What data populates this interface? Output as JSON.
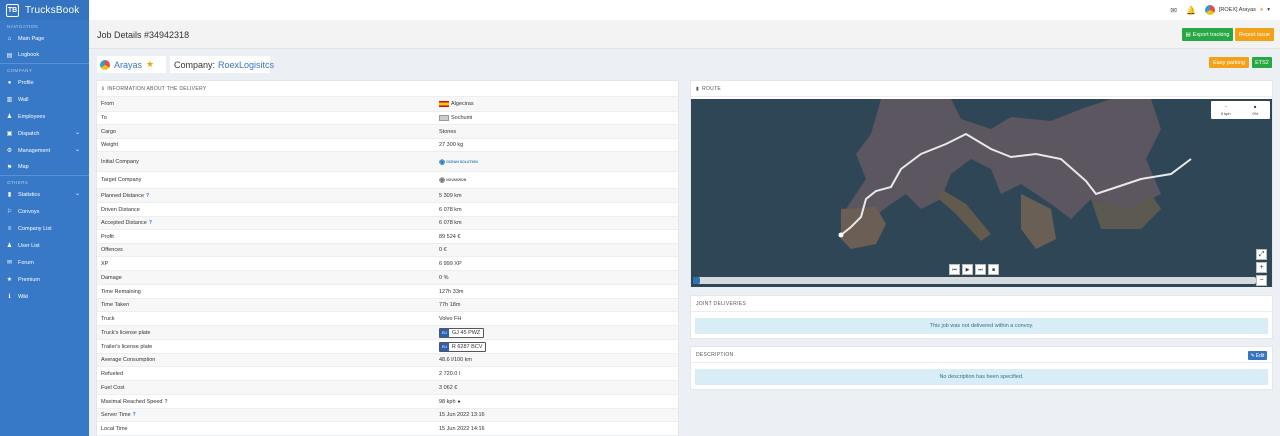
{
  "app": {
    "name": "TrucksBook",
    "logo_text": "TB"
  },
  "sidebar": {
    "sections": [
      "Navigation",
      "Company",
      "Others"
    ],
    "items": [
      {
        "label": "Main Page",
        "icon": "home-icon"
      },
      {
        "label": "Logbook",
        "icon": "book-icon"
      },
      {
        "label": "Profile",
        "icon": "user-icon"
      },
      {
        "label": "Wall",
        "icon": "wall-icon"
      },
      {
        "label": "Employees",
        "icon": "users-icon"
      },
      {
        "label": "Dispatch",
        "icon": "truck-icon"
      },
      {
        "label": "Management",
        "icon": "gear-icon"
      },
      {
        "label": "Map",
        "icon": "map-icon"
      },
      {
        "label": "Statistics",
        "icon": "chart-icon"
      },
      {
        "label": "Convoys",
        "icon": "convoy-icon"
      },
      {
        "label": "Company List",
        "icon": "list-icon"
      },
      {
        "label": "User List",
        "icon": "user-list-icon"
      },
      {
        "label": "Forum",
        "icon": "forum-icon"
      },
      {
        "label": "Premium",
        "icon": "star-icon"
      },
      {
        "label": "Wiki",
        "icon": "info-icon"
      }
    ]
  },
  "topbar": {
    "user_label": "[ROEX] Arayas"
  },
  "page": {
    "title": "Job Details #34942318"
  },
  "actions": {
    "export": "Export tracking",
    "report": "Report issue"
  },
  "driver": {
    "name": "Arayas"
  },
  "company": {
    "prefix": "Company:",
    "name": "RoexLogisitcs"
  },
  "badges": {
    "parking": "Easy parking",
    "game": "ETS2"
  },
  "info": {
    "heading": "Information about the delivery",
    "rows": [
      {
        "label": "From",
        "value": "Algeciras"
      },
      {
        "label": "To",
        "value": "Sochumi"
      },
      {
        "label": "Cargo",
        "value": "Stones"
      },
      {
        "label": "Weight",
        "value": "27 300 kg"
      },
      {
        "label": "Initial Company",
        "value": "OCEAN SOLUTION"
      },
      {
        "label": "Target Company",
        "value": "NOVAKRON"
      },
      {
        "label": "Planned Distance",
        "value": "5 309 km"
      },
      {
        "label": "Driven Distance",
        "value": "6 078 km"
      },
      {
        "label": "Accepted Distance",
        "value": "6 078 km"
      },
      {
        "label": "Profit",
        "value": "89 524 €"
      },
      {
        "label": "Offences",
        "value": "0 €"
      },
      {
        "label": "XP",
        "value": "6 999 XP"
      },
      {
        "label": "Damage",
        "value": "0 %"
      },
      {
        "label": "Time Remaining",
        "value": "127h 33m"
      },
      {
        "label": "Time Taken",
        "value": "77h 18m"
      },
      {
        "label": "Truck",
        "value": "Volvo FH"
      },
      {
        "label": "Truck's license plate",
        "value": "GJ 45 PWZ"
      },
      {
        "label": "Trailer's license plate",
        "value": "R 6287 BCV"
      },
      {
        "label": "Average Consumption",
        "value": "48.6 l/100 km"
      },
      {
        "label": "Refueled",
        "value": "2 720.0 l"
      },
      {
        "label": "Fuel Cost",
        "value": "3 062 €"
      },
      {
        "label": "Maximal Reached Speed",
        "value": "98 kph"
      },
      {
        "label": "Server Time",
        "value": "15 Jun 2022 13:16"
      },
      {
        "label": "Local Time",
        "value": "15 Jun 2022 14:16"
      }
    ]
  },
  "plate_country": "EU",
  "route": {
    "heading": "Route",
    "speed": "0 kph",
    "progress": "0%",
    "progress_value": 0
  },
  "joint": {
    "heading": "Joint deliveries",
    "message": "This job was not delivered within a convoy."
  },
  "description": {
    "heading": "Description",
    "edit": "Edit",
    "message": "No description has been specified."
  },
  "colors": {
    "sidebar": "#3778c7",
    "success": "#27a844",
    "warning": "#f4a11a",
    "link": "#3a74c0",
    "info_bg": "#d9edf7"
  }
}
